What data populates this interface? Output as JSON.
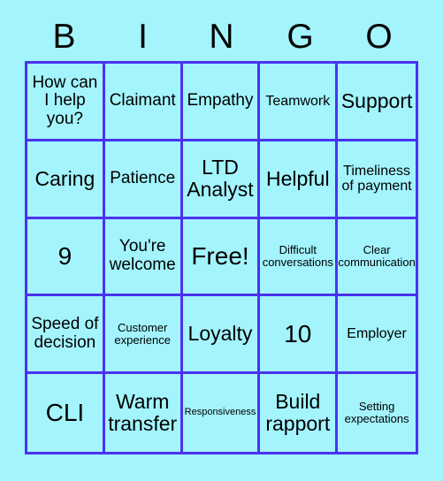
{
  "header": {
    "letters": [
      "B",
      "I",
      "N",
      "G",
      "O"
    ]
  },
  "colors": {
    "background": "#a3f4fd",
    "cell_fill": "#a3f4fd",
    "grid_line": "#4b32f0",
    "text": "#000000"
  },
  "grid": {
    "rows": 5,
    "columns": 5,
    "cells": [
      {
        "text": "How can I help you?",
        "size": "sz-l"
      },
      {
        "text": "Claimant",
        "size": "sz-l"
      },
      {
        "text": "Empathy",
        "size": "sz-l"
      },
      {
        "text": "Teamwork",
        "size": "sz-m"
      },
      {
        "text": "Support",
        "size": "sz-xl"
      },
      {
        "text": "Caring",
        "size": "sz-xl"
      },
      {
        "text": "Patience",
        "size": "sz-l"
      },
      {
        "text": "LTD Analyst",
        "size": "sz-xl"
      },
      {
        "text": "Helpful",
        "size": "sz-xl"
      },
      {
        "text": "Timeliness of payment",
        "size": "sz-m"
      },
      {
        "text": "9",
        "size": "sz-xxl"
      },
      {
        "text": "You're welcome",
        "size": "sz-l"
      },
      {
        "text": "Free!",
        "size": "sz-xxl"
      },
      {
        "text": "Difficult conversations",
        "size": "sz-s"
      },
      {
        "text": "Clear communication",
        "size": "sz-s"
      },
      {
        "text": "Speed of decision",
        "size": "sz-l"
      },
      {
        "text": "Customer experience",
        "size": "sz-s"
      },
      {
        "text": "Loyalty",
        "size": "sz-xl"
      },
      {
        "text": "10",
        "size": "sz-xxl"
      },
      {
        "text": "Employer",
        "size": "sz-m"
      },
      {
        "text": "CLI",
        "size": "sz-xxl"
      },
      {
        "text": "Warm transfer",
        "size": "sz-xl"
      },
      {
        "text": "Responsiveness",
        "size": "sz-xs"
      },
      {
        "text": "Build rapport",
        "size": "sz-xl"
      },
      {
        "text": "Setting expectations",
        "size": "sz-s"
      }
    ]
  }
}
